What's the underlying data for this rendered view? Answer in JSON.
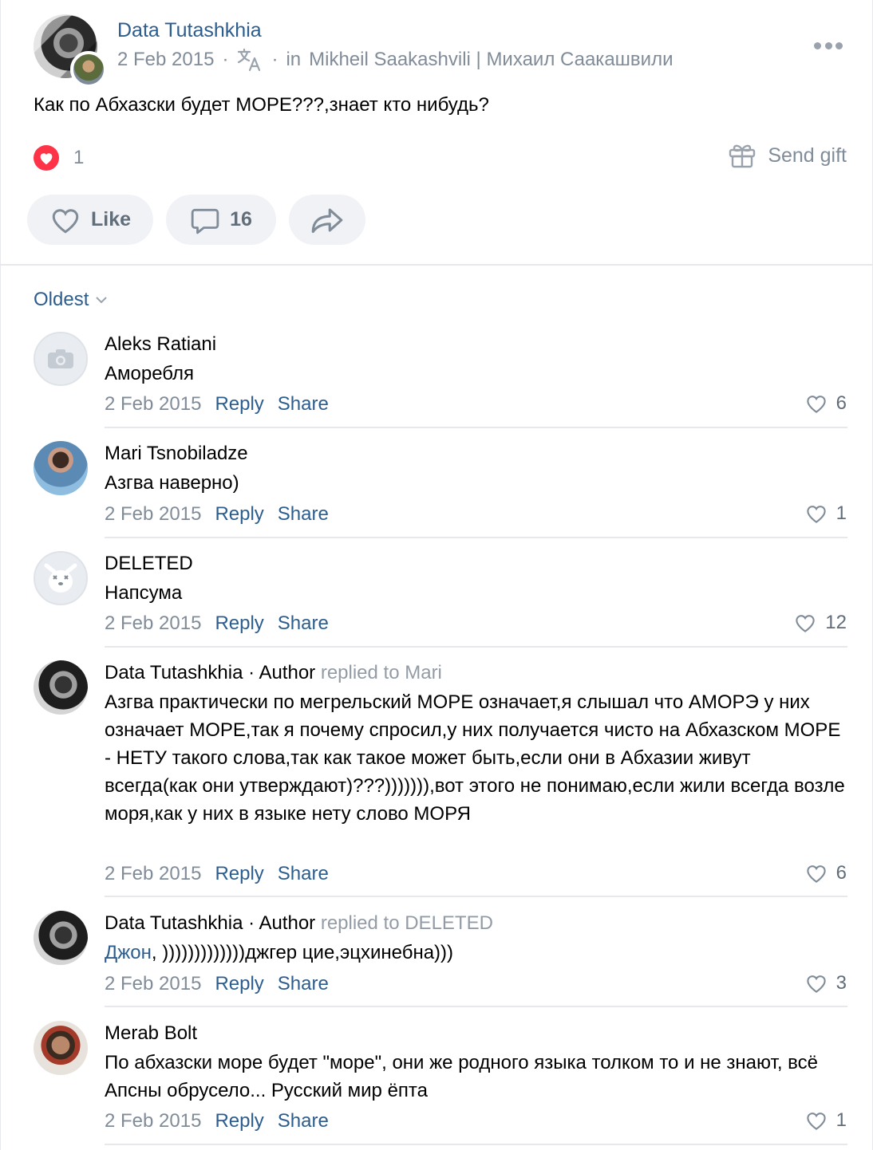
{
  "post": {
    "author": "Data Tutashkhia",
    "date": "2 Feb 2015",
    "separator1": "·",
    "separator2": "·",
    "in_prefix": "in",
    "community": "Mikheil Saakashvili | Михаил Саакашвили",
    "text": "Как по Абхазски будет МОРЕ???,знает кто нибудь?",
    "reaction_count": "1",
    "send_gift_label": "Send gift",
    "like_label": "Like",
    "comment_count": "16",
    "colors": {
      "link": "#2c5d8f",
      "muted": "#818c99",
      "heart": "#ff3347",
      "button_bg": "#f0f2f5"
    }
  },
  "comments_section": {
    "sort_label": "Oldest",
    "reply_label": "Reply",
    "share_label": "Share",
    "items": [
      {
        "name": "Aleks Ratiani",
        "text": "Аморебля",
        "date": "2 Feb 2015",
        "likes": "6",
        "avatar": "camera-placeholder"
      },
      {
        "name": "Mari Tsnobiladze",
        "text": "Азгва наверно)",
        "date": "2 Feb 2015",
        "likes": "1",
        "avatar": "photo"
      },
      {
        "name": "DELETED",
        "text": "Напсума",
        "date": "2 Feb 2015",
        "likes": "12",
        "avatar": "deleted-dog"
      },
      {
        "name": "Data Tutashkhia",
        "author_tag": "· Author",
        "replied": "replied to Mari",
        "text": "Азгва практически по мегрельский МОРЕ означает,я слышал что АМОРЭ у них означает МОРЕ,так я почему спросил,у них получается чисто на Абхазском МОРЕ - НЕТУ такого слова,так как такое может быть,если они в Абхазии живут всегда(как они утверждают)???))))))),вот этого не понимаю,если жили всегда возле моря,как у них в языке нету слово МОРЯ",
        "date": "2 Feb 2015",
        "likes": "6",
        "avatar": "photo"
      },
      {
        "name": "Data Tutashkhia",
        "author_tag": "· Author",
        "replied": "replied to DELETED",
        "mention": "Джон",
        "text": ", )))))))))))))джгер цие,эцхинебна)))",
        "date": "2 Feb 2015",
        "likes": "3",
        "avatar": "photo"
      },
      {
        "name": "Merab Bolt",
        "text": "По абхазски море будет \"море\", они же родного языка толком то и не знают, всё Апсны обрусело... Русский мир ёпта",
        "date": "2 Feb 2015",
        "likes": "1",
        "avatar": "photo"
      }
    ]
  }
}
